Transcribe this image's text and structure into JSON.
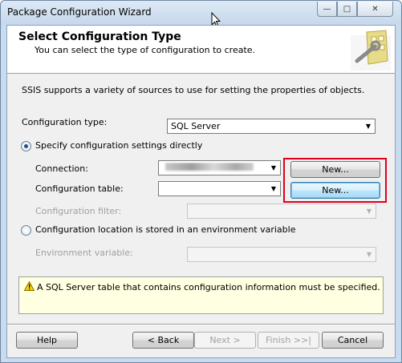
{
  "window": {
    "title": "Package Configuration Wizard",
    "controls": {
      "minimize": "—",
      "maximize": "□",
      "close": "✕"
    }
  },
  "header": {
    "title": "Select Configuration Type",
    "subtitle": "You can select the type of configuration to create."
  },
  "description": "SSIS supports a variety of sources to use for setting the properties of objects.",
  "config_type": {
    "label": "Configuration type:",
    "value": "SQL Server"
  },
  "option_direct": {
    "label": "Specify configuration settings directly",
    "selected": true,
    "connection_label": "Connection:",
    "connection_new": "New...",
    "table_label": "Configuration table:",
    "table_value": "",
    "table_new": "New...",
    "filter_label": "Configuration filter:",
    "filter_value": ""
  },
  "option_env": {
    "label": "Configuration location is stored in an environment variable",
    "selected": false,
    "env_label": "Environment variable:",
    "env_value": ""
  },
  "message": "A SQL Server table that contains configuration information must be specified.",
  "footer": {
    "help": "Help",
    "back": "< Back",
    "next": "Next >",
    "finish": "Finish >>|",
    "cancel": "Cancel"
  },
  "colors": {
    "highlight": "#e0001b",
    "message_bg": "#ffffe1",
    "radio_dot": "#1d4f88"
  }
}
